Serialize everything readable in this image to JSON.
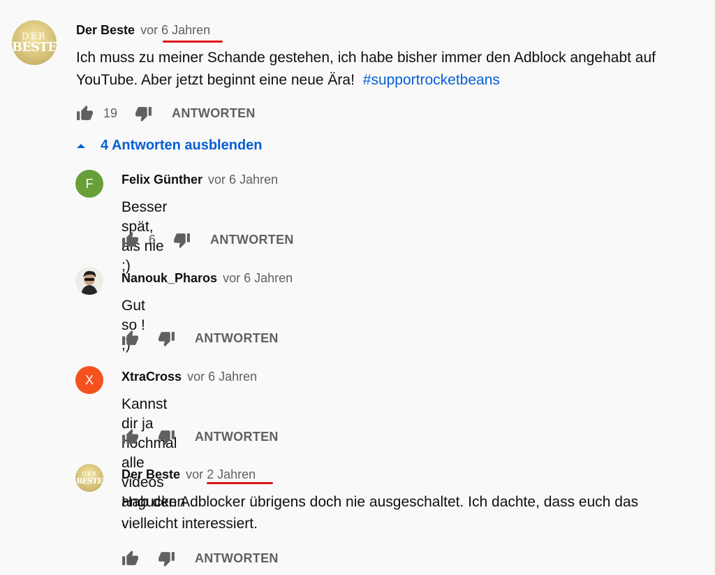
{
  "main_comment": {
    "author": "Der Beste",
    "time": "vor 6 Jahren",
    "text": "Ich muss zu meiner Schande gestehen, ich habe bisher immer den Adblock angehabt auf YouTube. Aber jetzt beginnt eine neue Ära!",
    "hashtag": "#supportrocketbeans",
    "likes": "19",
    "reply_label": "ANTWORTEN",
    "avatar_top": "DER",
    "avatar_bottom": "BESTE"
  },
  "replies_toggle": {
    "label": "4 Antworten ausblenden",
    "icon": "caret-up-icon"
  },
  "replies": [
    {
      "author": "Felix Günther",
      "time": "vor 6 Jahren",
      "text": "Besser spät, als nie ;)",
      "likes": "6",
      "reply_label": "ANTWORTEN",
      "avatar_letter": "F",
      "avatar_color": "#689f38"
    },
    {
      "author": "Nanouk_Pharos",
      "time": "vor 6 Jahren",
      "text": "Gut so ! ;)",
      "likes": "",
      "reply_label": "ANTWORTEN",
      "avatar_type": "photo"
    },
    {
      "author": "XtraCross",
      "time": "vor 6 Jahren",
      "text": "Kannst dir ja nochmal alle videos angucken .",
      "likes": "",
      "reply_label": "ANTWORTEN",
      "avatar_letter": "X",
      "avatar_color": "#f4511e"
    },
    {
      "author": "Der Beste",
      "time": "vor 2 Jahren",
      "text_line1": "Hab den Adblocker übrigens doch nie ausgeschaltet. Ich dachte, dass euch das",
      "text_line2": "vielleicht interessiert.",
      "likes": "",
      "reply_label": "ANTWORTEN",
      "avatar_top": "DER",
      "avatar_bottom": "BESTE"
    }
  ],
  "colors": {
    "background": "#f9f9f9",
    "link_blue": "#065fd4",
    "annotation_red": "#e0121a",
    "secondary_text": "#606060"
  }
}
